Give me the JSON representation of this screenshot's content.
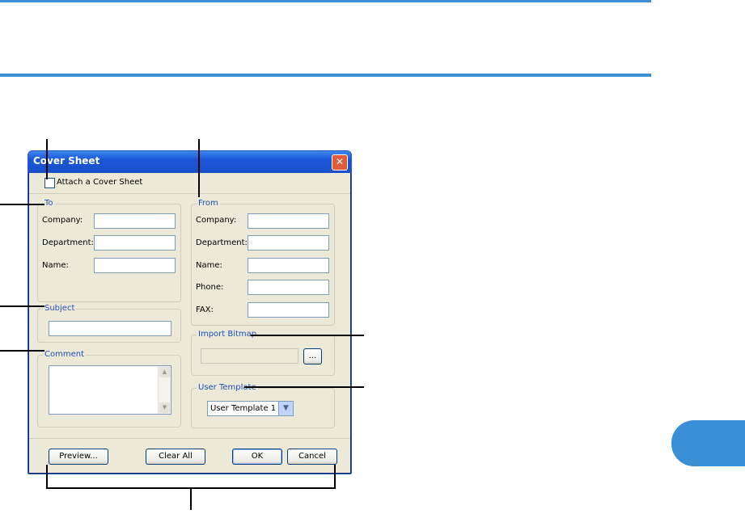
{
  "window": {
    "title": "Cover Sheet",
    "close_glyph": "✕"
  },
  "attach": {
    "label": "Attach a Cover Sheet",
    "checked": false
  },
  "to": {
    "legend": "To",
    "company_label": "Company:",
    "company_value": "",
    "department_label": "Department:",
    "department_value": "",
    "name_label": "Name:",
    "name_value": ""
  },
  "from": {
    "legend": "From",
    "company_label": "Company:",
    "company_value": "",
    "department_label": "Department:",
    "department_value": "",
    "name_label": "Name:",
    "name_value": "",
    "phone_label": "Phone:",
    "phone_value": "",
    "fax_label": "FAX:",
    "fax_value": ""
  },
  "subject": {
    "legend": "Subject",
    "value": ""
  },
  "comment": {
    "legend": "Comment",
    "value": "",
    "scroll_up_glyph": "▲",
    "scroll_down_glyph": "▼"
  },
  "import_bitmap": {
    "legend": "Import Bitmap",
    "path_value": "",
    "browse_label": "..."
  },
  "user_template": {
    "legend": "User Template",
    "selected": "User Template 1",
    "arrow_glyph": "▼"
  },
  "buttons": {
    "preview": "Preview...",
    "clear_all": "Clear All",
    "ok": "OK",
    "cancel": "Cancel"
  },
  "colors": {
    "accent": "#3a8fd6",
    "titlebar": "#1a57d8",
    "legend_text": "#1d4fb8",
    "dialog_bg": "#ece9d8"
  }
}
